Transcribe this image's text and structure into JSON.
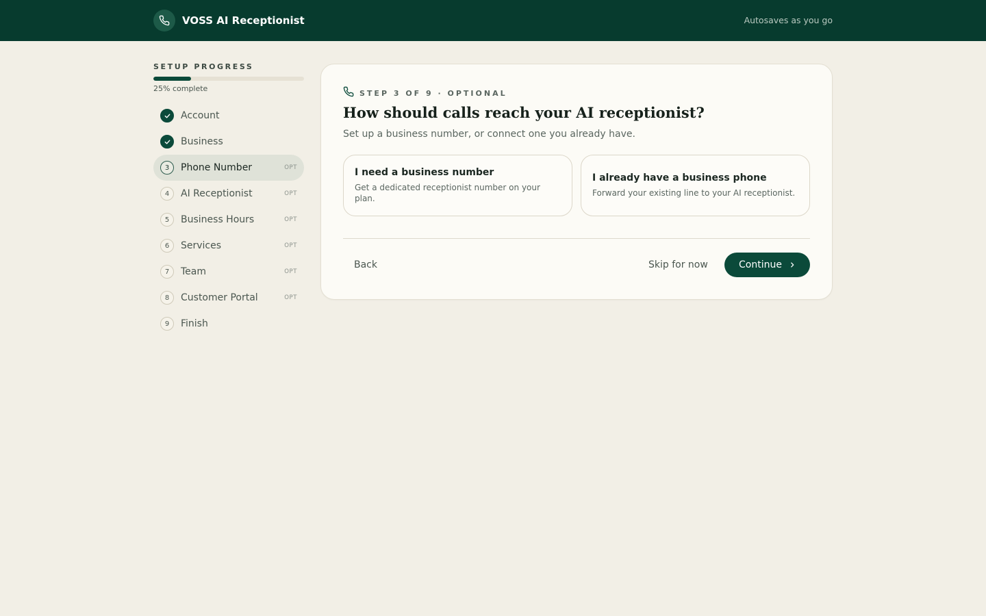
{
  "header": {
    "brand_name": "VOSS AI Receptionist",
    "brand_icon": "phone-icon",
    "autosave_text": "Autosaves as you go"
  },
  "sidebar": {
    "progress_title": "SETUP PROGRESS",
    "progress_fraction": 0.25,
    "progress_text": "25% complete",
    "steps": [
      {
        "label": "Account",
        "marker": "",
        "status": "done",
        "opt": ""
      },
      {
        "label": "Business",
        "marker": "",
        "status": "done",
        "opt": ""
      },
      {
        "label": "Phone Number",
        "marker": "3",
        "status": "active",
        "opt": "OPT"
      },
      {
        "label": "AI Receptionist",
        "marker": "4",
        "status": "pending",
        "opt": "OPT"
      },
      {
        "label": "Business Hours",
        "marker": "5",
        "status": "pending",
        "opt": "OPT"
      },
      {
        "label": "Services",
        "marker": "6",
        "status": "pending",
        "opt": "OPT"
      },
      {
        "label": "Team",
        "marker": "7",
        "status": "pending",
        "opt": "OPT"
      },
      {
        "label": "Customer Portal",
        "marker": "8",
        "status": "pending",
        "opt": "OPT"
      },
      {
        "label": "Finish",
        "marker": "9",
        "status": "pending",
        "opt": ""
      }
    ]
  },
  "main": {
    "eyebrow": "STEP 3 OF 9 · OPTIONAL",
    "eyebrow_icon": "phone-icon",
    "title": "How should calls reach your AI receptionist?",
    "subtitle": "Set up a business number, or connect one you already have.",
    "options": [
      {
        "title": "I need a business number",
        "description": "Get a dedicated receptionist number on your plan."
      },
      {
        "title": "I already have a business phone",
        "description": "Forward your existing line to your AI receptionist."
      }
    ],
    "back_label": "Back",
    "skip_label": "Skip for now",
    "continue_label": "Continue",
    "continue_icon": "chevron-right-icon"
  },
  "colors": {
    "brand": "#073b2e",
    "accent": "#0b4a3a",
    "background": "#f2efe6"
  }
}
